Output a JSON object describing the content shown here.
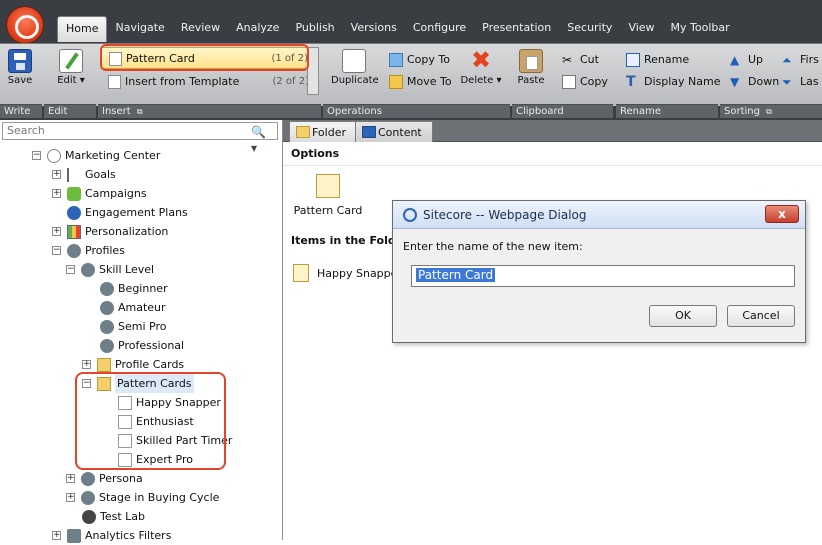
{
  "ribbon": {
    "tabs": [
      "Home",
      "Navigate",
      "Review",
      "Analyze",
      "Publish",
      "Versions",
      "Configure",
      "Presentation",
      "Security",
      "View",
      "My Toolbar"
    ],
    "active_tab": "Home",
    "groups": {
      "write": {
        "label": "Write",
        "save": "Save"
      },
      "edit": {
        "label": "Edit",
        "edit": "Edit"
      },
      "insert": {
        "label": "Insert",
        "items": [
          {
            "label": "Pattern Card",
            "count": "(1 of 2)"
          },
          {
            "label": "Insert from Template",
            "count": "(2 of 2)"
          }
        ]
      },
      "operations": {
        "label": "Operations",
        "duplicate": "Duplicate",
        "copy_to": "Copy To",
        "move_to": "Move To",
        "delete": "Delete"
      },
      "clipboard": {
        "label": "Clipboard",
        "paste": "Paste",
        "cut": "Cut",
        "copy": "Copy"
      },
      "rename": {
        "label": "Rename",
        "rename": "Rename",
        "display_name": "Display Name"
      },
      "sorting": {
        "label": "Sorting",
        "up": "Up",
        "down": "Down",
        "first": "Firs",
        "last": "Las"
      }
    }
  },
  "left_pane": {
    "search_placeholder": "Search",
    "tree": [
      {
        "label": "Marketing Center",
        "indent": 0,
        "expander": "−"
      },
      {
        "label": "Goals",
        "indent": 1,
        "expander": "+"
      },
      {
        "label": "Campaigns",
        "indent": 1,
        "expander": "+"
      },
      {
        "label": "Engagement Plans",
        "indent": 1,
        "expander": ""
      },
      {
        "label": "Personalization",
        "indent": 1,
        "expander": "+"
      },
      {
        "label": "Profiles",
        "indent": 1,
        "expander": "−"
      },
      {
        "label": "Skill Level",
        "indent": 2,
        "expander": "−"
      },
      {
        "label": "Beginner",
        "indent": 3,
        "expander": ""
      },
      {
        "label": "Amateur",
        "indent": 3,
        "expander": ""
      },
      {
        "label": "Semi Pro",
        "indent": 3,
        "expander": ""
      },
      {
        "label": "Professional",
        "indent": 3,
        "expander": ""
      },
      {
        "label": "Profile Cards",
        "indent": 2,
        "expander": "+"
      },
      {
        "label": "Pattern Cards",
        "indent": 2,
        "expander": "−",
        "selected": true
      },
      {
        "label": "Happy Snapper",
        "indent": 3,
        "expander": ""
      },
      {
        "label": "Enthusiast",
        "indent": 3,
        "expander": ""
      },
      {
        "label": "Skilled Part Timer",
        "indent": 3,
        "expander": ""
      },
      {
        "label": "Expert Pro",
        "indent": 3,
        "expander": ""
      },
      {
        "label": "Persona",
        "indent": 1,
        "expander": "+"
      },
      {
        "label": "Stage in Buying Cycle",
        "indent": 1,
        "expander": "+"
      },
      {
        "label": "Test Lab",
        "indent": 1,
        "expander": ""
      },
      {
        "label": "Analytics Filters",
        "indent": 1,
        "expander": "+"
      }
    ]
  },
  "right_pane": {
    "tabs": [
      "Folder",
      "Content"
    ],
    "options_title": "Options",
    "option_label": "Pattern Card",
    "items_heading": "Items in the Folder",
    "items": [
      "Happy Snapper"
    ]
  },
  "dialog": {
    "title": "Sitecore -- Webpage Dialog",
    "prompt": "Enter the name of the new item:",
    "value": "Pattern Card",
    "ok": "OK",
    "cancel": "Cancel",
    "close": "x"
  }
}
